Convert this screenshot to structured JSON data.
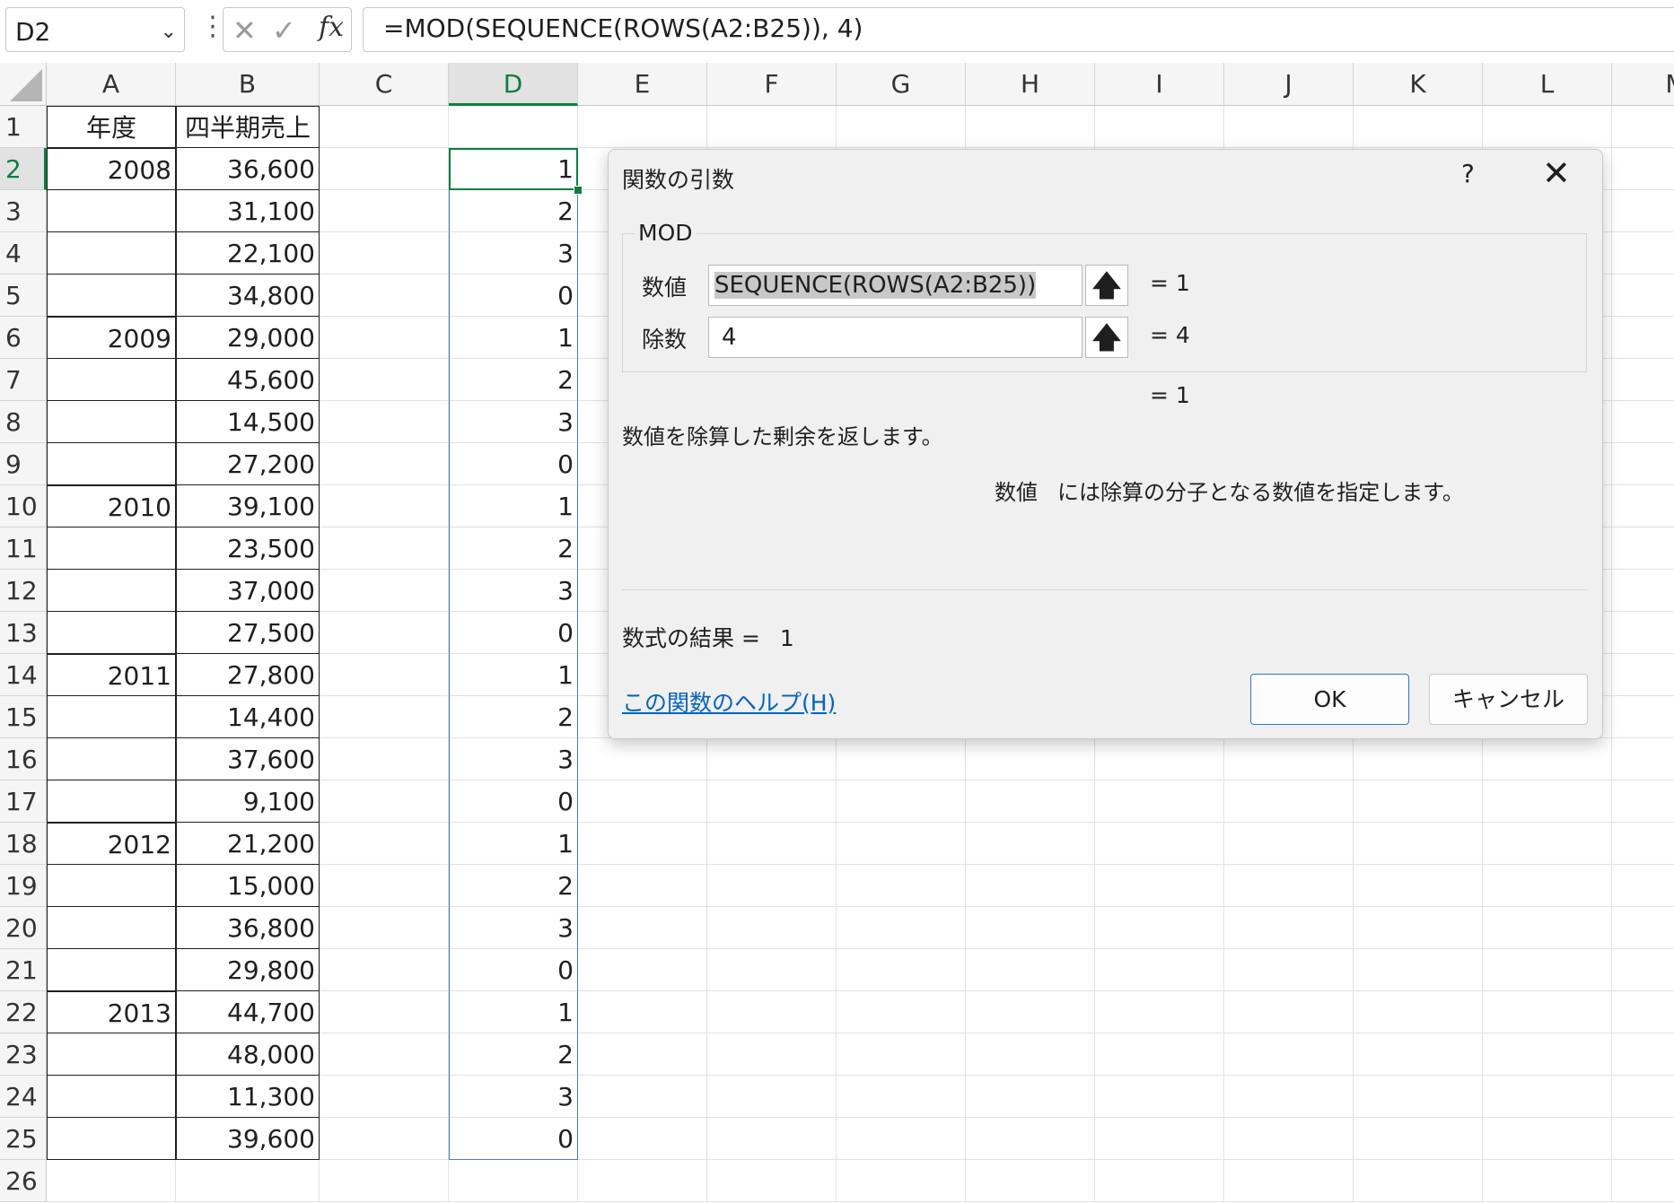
{
  "formula_bar": {
    "name_box": "D2",
    "formula": "=MOD(SEQUENCE(ROWS(A2:B25)), 4)",
    "icons": [
      "cancel-icon",
      "enter-icon",
      "function-icon"
    ],
    "fx_label": "fx"
  },
  "columns": [
    "A",
    "B",
    "C",
    "D",
    "E",
    "F",
    "G",
    "H",
    "I",
    "J",
    "K",
    "L",
    "M"
  ],
  "rows": [
    "1",
    "2",
    "3",
    "4",
    "5",
    "6",
    "7",
    "8",
    "9",
    "10",
    "11",
    "12",
    "13",
    "14",
    "15",
    "16",
    "17",
    "18",
    "19",
    "20",
    "21",
    "22",
    "23",
    "24",
    "25",
    "26"
  ],
  "header_row": {
    "a": "年度",
    "b": "四半期売上"
  },
  "years": [
    "2008",
    "",
    "",
    "",
    "2009",
    "",
    "",
    "",
    "2010",
    "",
    "",
    "",
    "2011",
    "",
    "",
    "",
    "2012",
    "",
    "",
    "",
    "2013",
    "",
    "",
    ""
  ],
  "sales": [
    "36,600",
    "31,100",
    "22,100",
    "34,800",
    "29,000",
    "45,600",
    "14,500",
    "27,200",
    "39,100",
    "23,500",
    "37,000",
    "27,500",
    "27,800",
    "14,400",
    "37,600",
    "9,100",
    "21,200",
    "15,000",
    "36,800",
    "29,800",
    "44,700",
    "48,000",
    "11,300",
    "39,600"
  ],
  "mod_values": [
    "1",
    "2",
    "3",
    "0",
    "1",
    "2",
    "3",
    "0",
    "1",
    "2",
    "3",
    "0",
    "1",
    "2",
    "3",
    "0",
    "1",
    "2",
    "3",
    "0",
    "1",
    "2",
    "3",
    "0"
  ],
  "selected_column": "D",
  "selected_row": "2",
  "dialog": {
    "title": "関数の引数",
    "help": "?",
    "close": "✕",
    "function_name": "MOD",
    "arg1_label": "数値",
    "arg1_value": "SEQUENCE(ROWS(A2:B25))",
    "arg1_result": "= 1",
    "arg2_label": "除数",
    "arg2_value": "4",
    "arg2_result": "= 4",
    "overall_result": "= 1",
    "description": "数値を除算した剰余を返します。",
    "arg_description_name": "数値",
    "arg_description": "には除算の分子となる数値を指定します。",
    "formula_result_label": "数式の結果 =",
    "formula_result_value": "1",
    "help_link": "この関数のヘルプ(H)",
    "ok_label": "OK",
    "cancel_label": "キャンセル"
  },
  "colors": {
    "selection_green": "#107c41",
    "range_blue": "#4a7ebb",
    "link_blue": "#0563c1"
  }
}
